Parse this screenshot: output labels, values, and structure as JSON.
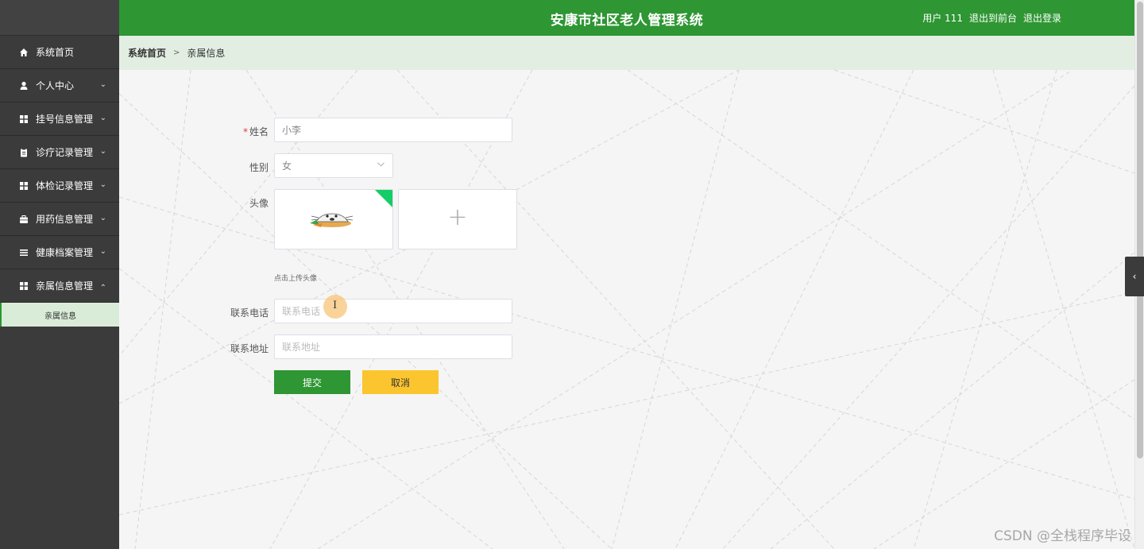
{
  "sidebar": {
    "items": [
      {
        "label": "系统首页",
        "icon": "home-icon",
        "caret": ""
      },
      {
        "label": "个人中心",
        "icon": "user-icon",
        "caret": "⌄"
      },
      {
        "label": "挂号信息管理",
        "icon": "grid-icon",
        "caret": "⌄"
      },
      {
        "label": "诊疗记录管理",
        "icon": "clipboard-icon",
        "caret": "⌄"
      },
      {
        "label": "体检记录管理",
        "icon": "grid-icon",
        "caret": "⌄"
      },
      {
        "label": "用药信息管理",
        "icon": "briefcase-icon",
        "caret": "⌄"
      },
      {
        "label": "健康档案管理",
        "icon": "list-icon",
        "caret": "⌄"
      },
      {
        "label": "亲属信息管理",
        "icon": "grid-icon",
        "caret": "⌃"
      }
    ],
    "submenu": {
      "label": "亲属信息"
    }
  },
  "header": {
    "title": "安康市社区老人管理系统",
    "user": "用户 111",
    "to_front": "退出到前台",
    "logout": "退出登录"
  },
  "breadcrumb": {
    "home": "系统首页",
    "separator": ">",
    "current": "亲属信息"
  },
  "form": {
    "name": {
      "required_mark": "*",
      "label": "姓名",
      "value": "小李"
    },
    "gender": {
      "label": "性别",
      "value": "女"
    },
    "avatar": {
      "label": "头像",
      "tip": "点击上传头像",
      "plus": "+"
    },
    "phone": {
      "label": "联系电话",
      "placeholder": "联系电话"
    },
    "address": {
      "label": "联系地址",
      "placeholder": "联系地址"
    },
    "submit": "提交",
    "cancel": "取消"
  },
  "float_tab": {
    "icon": "chevron-left-icon",
    "glyph": "‹"
  },
  "watermark": "CSDN @全栈程序毕设",
  "colors": {
    "header_bg": "#2e9633",
    "sidebar_bg": "#3b3b3b",
    "breadcrumb_bg": "#e2eee2",
    "submit_bg": "#2e9633",
    "cancel_bg": "#fbc52f",
    "required": "#e4393c"
  }
}
